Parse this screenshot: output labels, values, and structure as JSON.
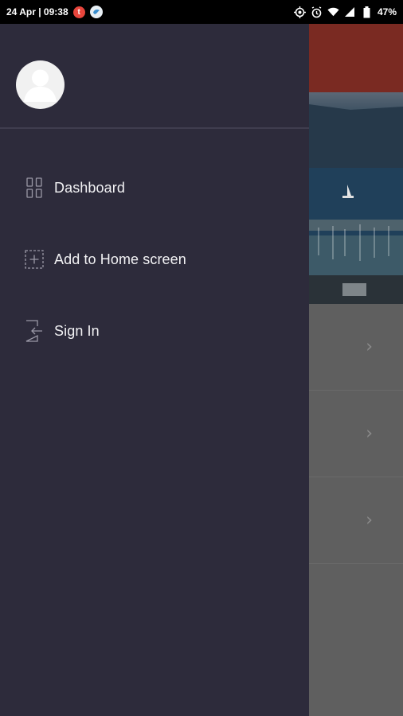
{
  "status_bar": {
    "datetime": "24 Apr | 09:38",
    "notification_letter": "t",
    "battery_percent": "47%"
  },
  "drawer": {
    "items": [
      {
        "label": "Dashboard",
        "icon": "grid-icon"
      },
      {
        "label": "Add to Home screen",
        "icon": "add-box-icon"
      },
      {
        "label": "Sign In",
        "icon": "sign-in-icon"
      }
    ]
  },
  "colors": {
    "drawer_bg": "#2d2b3b",
    "app_bar": "#7a2a22",
    "status_bar": "#000000"
  }
}
